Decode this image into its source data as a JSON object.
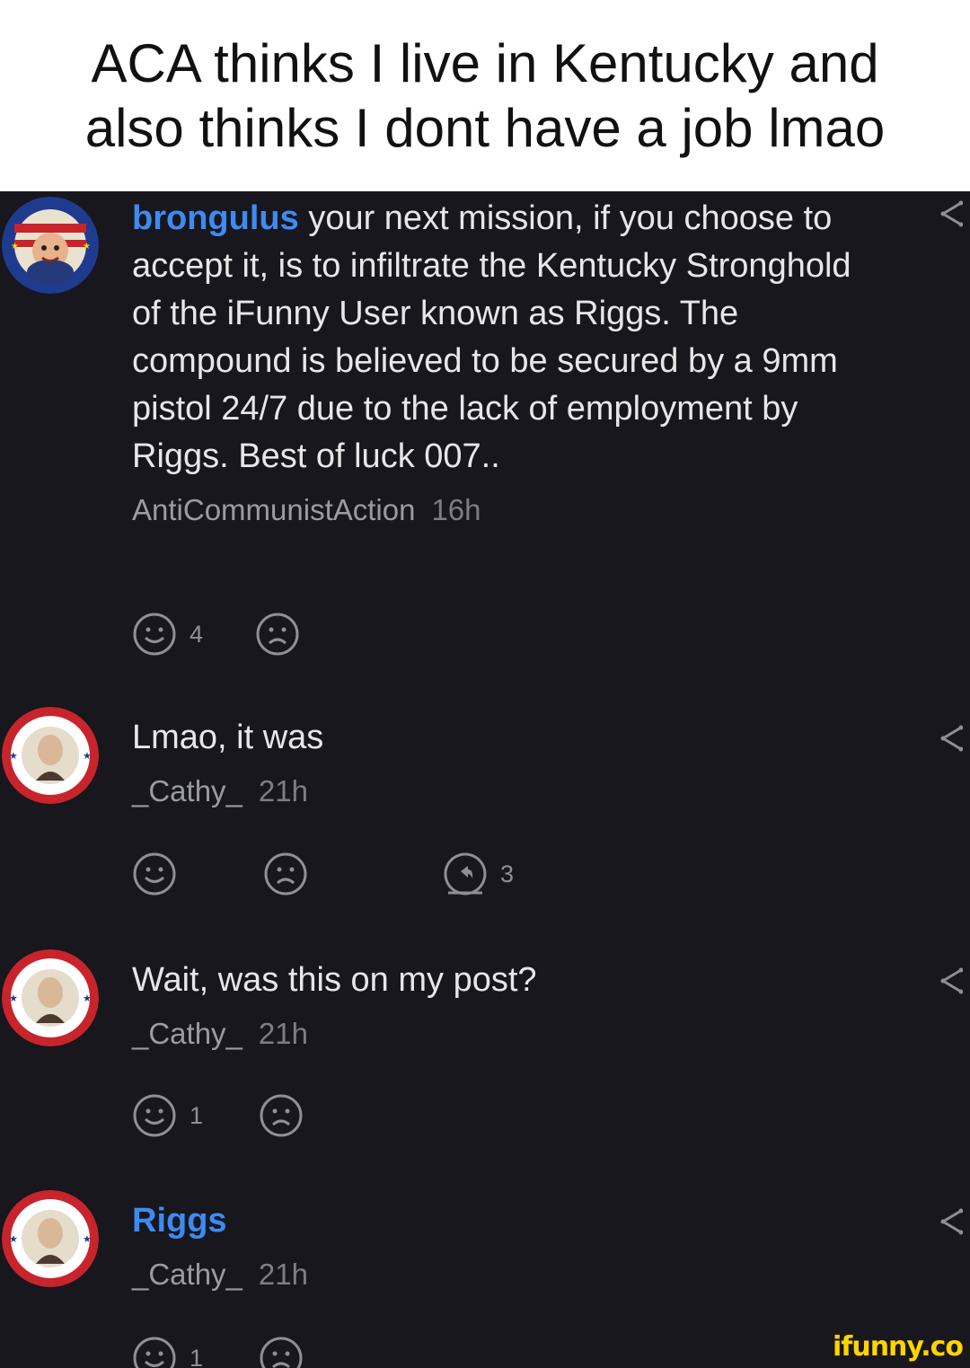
{
  "caption": "ACA thinks I live in Kentucky and also thinks I dont have a job lmao",
  "comments": [
    {
      "mention": "brongulus",
      "text": " your next mission, if you choose to accept it, is to infiltrate the Kentucky Stronghold of the iFunny User known as Riggs. The compound is believed to be secured by a 9mm pistol 24/7 due to the lack of employment by Riggs. Best of luck 007..",
      "author": "AntiCommunistAction",
      "time": "16h",
      "smile_count": "4",
      "avatar": "aca-avatar"
    },
    {
      "mention": "",
      "text": "Lmao, it was",
      "author": "_Cathy_",
      "time": "21h",
      "smile_count": "",
      "replies_count": "3",
      "avatar": "liberty-avatar"
    },
    {
      "mention": "",
      "text": "Wait, was this on my post?",
      "author": "_Cathy_",
      "time": "21h",
      "smile_count": "1",
      "avatar": "liberty-avatar"
    },
    {
      "mention": "Riggs",
      "text": "",
      "author": "_Cathy_",
      "time": "21h",
      "smile_count": "1",
      "avatar": "liberty-avatar"
    }
  ],
  "watermark": "ifunny.co",
  "colors": {
    "background": "#17171d",
    "mention": "#3d8bf2",
    "watermark": "#ffd400",
    "caption_bg": "#ffffff"
  }
}
